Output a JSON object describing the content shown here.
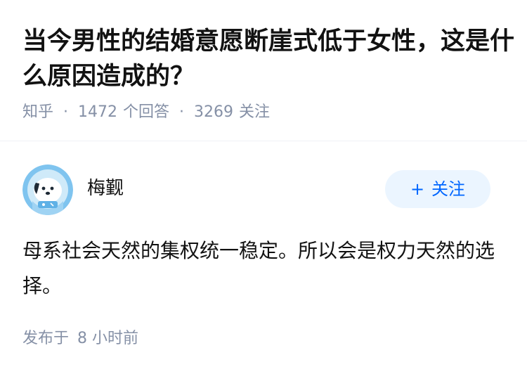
{
  "question": {
    "title": "当今男性的结婚意愿断崖式低于女性，这是什么原因造成的？"
  },
  "meta": {
    "source": "知乎",
    "answers_count": "1472",
    "answers_label": "个回答",
    "followers_count": "3269",
    "followers_label": "关注"
  },
  "author": {
    "name": "梅觐",
    "avatar_icon": "astronaut-dog-avatar",
    "follow_label": "关注",
    "follow_icon": "plus-icon"
  },
  "answer": {
    "text": "母系社会天然的集权统一稳定。所以会是权力天然的选择。"
  },
  "footer": {
    "published_prefix": "发布于",
    "published_time": "8 小时前"
  },
  "colors": {
    "primary_text": "#121212",
    "meta_text": "#8590a6",
    "follow_bg": "#ebf5ff",
    "follow_text": "#0066ff"
  }
}
